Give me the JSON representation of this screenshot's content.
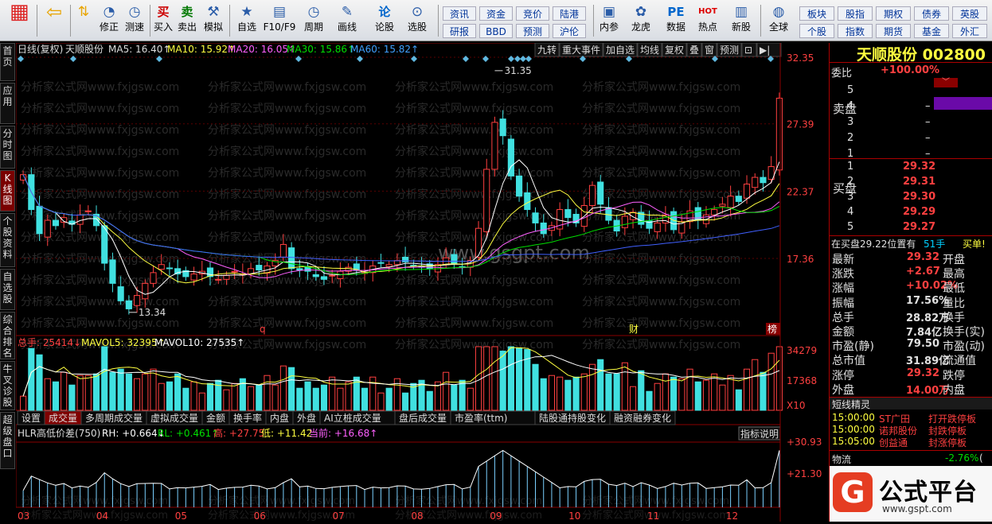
{
  "toolbar": {
    "items": [
      {
        "label": "",
        "icon": "home-grid-icon"
      },
      {
        "label": "",
        "icon": "back-arrow-icon"
      },
      {
        "label": "",
        "icon": "up-down-icon"
      },
      {
        "label": "修正",
        "icon": "correct-icon"
      },
      {
        "label": "测速",
        "icon": "clock-icon"
      },
      {
        "label": "买入",
        "icon": "buy-icon",
        "glyph": "买"
      },
      {
        "label": "卖出",
        "icon": "sell-icon",
        "glyph": "卖"
      },
      {
        "label": "模拟",
        "icon": "hammer-icon"
      },
      {
        "label": "自选",
        "icon": "star-icon"
      },
      {
        "label": "F10/F9",
        "icon": "f10-icon"
      },
      {
        "label": "周期",
        "icon": "period-icon"
      },
      {
        "label": "画线",
        "icon": "pen-icon"
      },
      {
        "label": "论股",
        "icon": "discuss-icon",
        "glyph": "论"
      },
      {
        "label": "选股",
        "icon": "select-stock-icon"
      },
      {
        "label": "内参",
        "icon": "chart-book-icon"
      },
      {
        "label": "龙虎",
        "icon": "dragon-icon"
      },
      {
        "label": "数据",
        "icon": "pe-icon",
        "glyph": "PE"
      },
      {
        "label": "热点",
        "icon": "hot-icon",
        "glyph": "HOT"
      },
      {
        "label": "新股",
        "icon": "new-stock-icon"
      },
      {
        "label": "全球",
        "icon": "globe-icon"
      }
    ],
    "small_buttons_left": [
      "资讯",
      "研报",
      "资金",
      "BBD",
      "竞价",
      "预测",
      "陆港",
      "沪伦"
    ],
    "small_buttons_right": [
      "板块",
      "个股",
      "股指",
      "指数",
      "期权",
      "期货",
      "债券",
      "基金",
      "英股",
      "外汇"
    ]
  },
  "leftnav": [
    "首页",
    "应用",
    "分时图",
    "K线图",
    "个股资料",
    "自选股",
    "综合排名",
    "牛叉诊股",
    "超级盘口"
  ],
  "chart": {
    "header": {
      "period": "日线(复权)",
      "name": "天顺股份",
      "ma5": "MA5: 16.40↑",
      "ma10": "MA10: 15.92↑",
      "ma20": "MA20: 16.05↑",
      "ma30": "MA30: 15.86↑",
      "ma60": "MA60: 15.82↑"
    },
    "top_buttons": [
      "九转",
      "重大事件",
      "加自选",
      "均线",
      "复权",
      "叠",
      "窗",
      "预测",
      "⊡",
      "▶|"
    ],
    "price_axis": [
      "32.35",
      "27.39",
      "22.37",
      "17.36"
    ],
    "high_label": "31.35",
    "low_label": "13.34",
    "event_markers": [
      "q",
      "财",
      "榜"
    ],
    "watermark_text": "分析家公式网www.fxjgsw.com",
    "center_watermark": "www.gsgpt.com",
    "vol_header": {
      "total": "总手: 25414↓",
      "mavol5": "MAVOL5: 32395↑",
      "mavol10": "MAVOL10: 27535↑"
    },
    "vol_axis": [
      "34279",
      "17368",
      "X10"
    ],
    "tabs": [
      "设置",
      "成交量",
      "多周期成交量",
      "虚拟成交量",
      "金额",
      "换手率",
      "内盘",
      "外盘",
      "AI立桩成交量",
      "盘后成交量",
      "市盈率(ttm)",
      "陆股通持股变化",
      "融资融券变化"
    ],
    "ind_header": {
      "name": "HLR高低价差(750)",
      "rh": "RH: +0.664↓",
      "rl": "RL: +0.461↑",
      "high": "高: +27.75",
      "low": "低: +11.42",
      "cur": "当前: +16.68↑"
    },
    "ind_btn": "指标说明",
    "ind_axis": [
      "+30.93",
      "+21.30"
    ],
    "months": [
      "03",
      "04",
      "05",
      "06",
      "07",
      "08",
      "09",
      "10",
      "11",
      "12"
    ]
  },
  "chart_data": {
    "type": "candlestick",
    "title": "天顺股份 日线(复权)",
    "ylim": [
      12.5,
      32.35
    ],
    "price_ticks": [
      32.35,
      27.39,
      22.37,
      17.36
    ],
    "high_point": 31.35,
    "low_point": 13.34,
    "close_path": [
      23.6,
      21.0,
      19.2,
      20.2,
      19.8,
      20.4,
      19.9,
      20.6,
      20.9,
      19.8,
      17.0,
      15.5,
      14.2,
      13.6,
      14.6,
      15.5,
      16.3,
      16.9,
      16.6,
      16.2,
      16.0,
      16.2,
      16.4,
      16.0,
      15.8,
      16.1,
      16.4,
      16.2,
      16.6,
      16.5,
      16.8,
      17.2,
      18.4,
      16.6,
      16.5,
      16.4,
      16.0,
      15.8,
      16.1,
      16.4,
      16.7,
      16.5,
      16.3,
      16.8,
      17.0,
      16.9,
      17.2,
      17.1,
      16.8,
      16.7,
      16.6,
      16.9,
      17.4,
      17.0,
      16.7,
      17.2,
      19.6,
      24.0,
      27.5,
      26.5,
      23.5,
      22.0,
      21.0,
      20.0,
      19.2,
      19.8,
      21.0,
      20.4,
      20.0,
      21.3,
      22.8,
      21.4,
      20.2,
      19.4,
      20.5,
      20.8,
      19.9,
      19.6,
      20.0,
      20.6,
      19.5,
      20.1,
      20.9,
      20.2,
      20.6,
      21.0,
      21.4,
      22.0,
      21.6,
      22.9,
      23.4,
      23.0,
      24.2,
      29.3
    ],
    "volume_ylim": [
      0,
      36000
    ],
    "volume_ticks": [
      34279,
      17368
    ],
    "hlr_ticks": [
      30.93,
      21.3
    ],
    "hlr": {
      "high": 27.75,
      "low": 11.42,
      "current": 16.68
    }
  },
  "quote": {
    "name": "天顺股份",
    "code": "002800",
    "weibi_label": "委比",
    "weibi": "+100.00%",
    "sell_label": "卖盘",
    "buy_label": "买盘",
    "sell": [
      {
        "lv": "5",
        "p": "",
        "v": ""
      },
      {
        "lv": "4",
        "p": "",
        "v": "–"
      },
      {
        "lv": "3",
        "p": "",
        "v": "–"
      },
      {
        "lv": "2",
        "p": "",
        "v": "–"
      },
      {
        "lv": "1",
        "p": "",
        "v": "–"
      }
    ],
    "buy": [
      {
        "lv": "1",
        "p": "29.32",
        "v": ""
      },
      {
        "lv": "2",
        "p": "29.31",
        "v": ""
      },
      {
        "lv": "3",
        "p": "29.30",
        "v": ""
      },
      {
        "lv": "4",
        "p": "29.29",
        "v": ""
      },
      {
        "lv": "5",
        "p": "29.27",
        "v": ""
      }
    ],
    "order_line": "在买盘29.22位置有",
    "order_qty": "51手",
    "order_tag": "买单!",
    "stats": [
      [
        "最新",
        "29.32",
        "开盘",
        ""
      ],
      [
        "涨跌",
        "+2.67",
        "最高",
        ""
      ],
      [
        "涨幅",
        "+10.02%",
        "最低",
        ""
      ],
      [
        "振幅",
        "17.56%",
        "量比",
        ""
      ],
      [
        "总手",
        "28.82万",
        "换手",
        ""
      ],
      [
        "金额",
        "7.84亿",
        "换手(实)",
        ""
      ],
      [
        "市盈(静)",
        "79.50",
        "市盈(动)",
        ""
      ],
      [
        "总市值",
        "31.89亿",
        "流通值",
        ""
      ],
      [
        "涨停",
        "29.32",
        "跌停",
        ""
      ],
      [
        "外盘",
        "14.00万",
        "内盘",
        ""
      ]
    ],
    "elf_title": "短线精灵",
    "elf": [
      [
        "15:00:00",
        "ST广田",
        "打开跌停板"
      ],
      [
        "15:00:00",
        "诺邦股份",
        "封跌停板"
      ],
      [
        "15:05:00",
        "创益通",
        "封涨停板"
      ]
    ],
    "bottom_name": "物流",
    "bottom_pct": "-2.76%",
    "bottom_tail": "(",
    "logo_text": "公式平台",
    "logo_url": "www.gspt.com"
  }
}
